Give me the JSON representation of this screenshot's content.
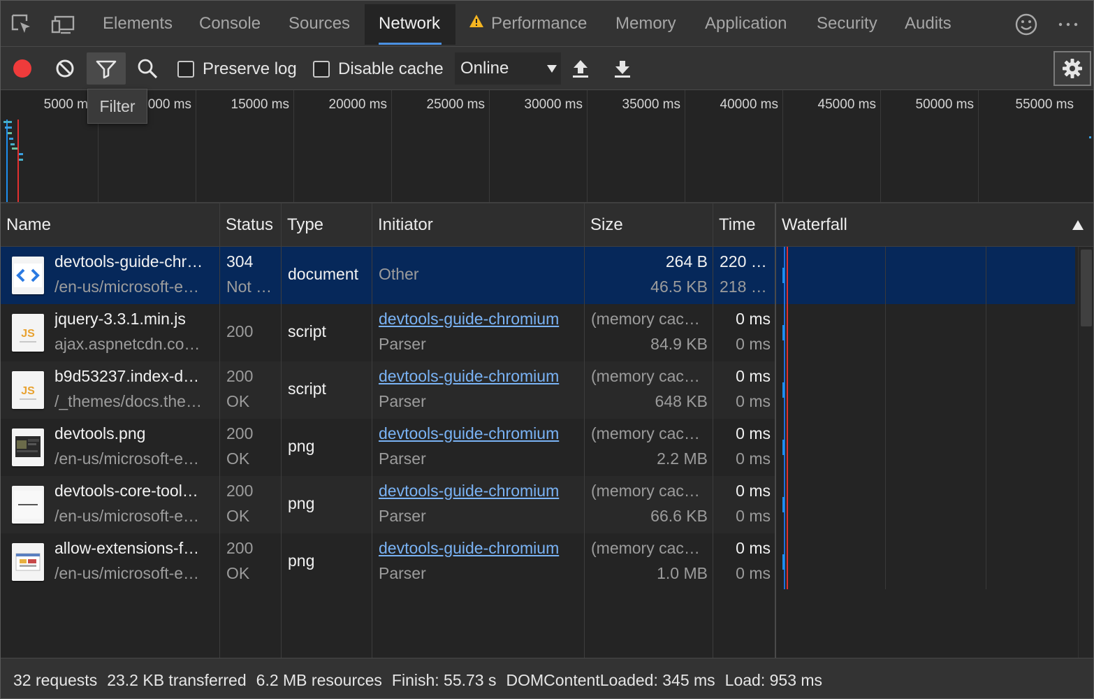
{
  "tabs": [
    {
      "label": "Elements"
    },
    {
      "label": "Console"
    },
    {
      "label": "Sources"
    },
    {
      "label": "Network"
    },
    {
      "label": "Performance"
    },
    {
      "label": "Memory"
    },
    {
      "label": "Application"
    },
    {
      "label": "Security"
    },
    {
      "label": "Audits"
    }
  ],
  "active_tab": "Network",
  "toolbar": {
    "preserve_log": "Preserve log",
    "disable_cache": "Disable cache",
    "throttle": "Online",
    "filter_tooltip": "Filter"
  },
  "overview": {
    "ticks": [
      "5000 ms",
      "10000 ms",
      "15000 ms",
      "20000 ms",
      "25000 ms",
      "30000 ms",
      "35000 ms",
      "40000 ms",
      "45000 ms",
      "50000 ms",
      "55000 ms"
    ],
    "visible_ticks": [
      "5000 m",
      "000 ms",
      "15000 ms",
      "20000 ms",
      "25000 ms",
      "30000 ms",
      "35000 ms",
      "40000 ms",
      "45000 ms",
      "50000 ms",
      "55000 ms"
    ]
  },
  "columns": {
    "name": "Name",
    "status": "Status",
    "type": "Type",
    "initiator": "Initiator",
    "size": "Size",
    "time": "Time",
    "waterfall": "Waterfall"
  },
  "requests": [
    {
      "name": "devtools-guide-chr…",
      "path": "/en-us/microsoft-e…",
      "status": "304",
      "status_text": "Not …",
      "type": "document",
      "initiator": "Other",
      "initiator_sub": "",
      "size": "264 B",
      "size_sub": "46.5 KB",
      "time": "220 …",
      "time_sub": "218 …",
      "icon": "html-file-icon"
    },
    {
      "name": "jquery-3.3.1.min.js",
      "path": "ajax.aspnetcdn.co…",
      "status": "200",
      "status_text": "",
      "type": "script",
      "initiator": "devtools-guide-chromium",
      "initiator_sub": "Parser",
      "size": "(memory cac…",
      "size_sub": "84.9 KB",
      "time": "0 ms",
      "time_sub": "0 ms",
      "icon": "js-file-icon"
    },
    {
      "name": "b9d53237.index-d…",
      "path": "/_themes/docs.the…",
      "status": "200",
      "status_text": "OK",
      "type": "script",
      "initiator": "devtools-guide-chromium",
      "initiator_sub": "Parser",
      "size": "(memory cac…",
      "size_sub": "648 KB",
      "time": "0 ms",
      "time_sub": "0 ms",
      "icon": "js-file-icon"
    },
    {
      "name": "devtools.png",
      "path": "/en-us/microsoft-e…",
      "status": "200",
      "status_text": "OK",
      "type": "png",
      "initiator": "devtools-guide-chromium",
      "initiator_sub": "Parser",
      "size": "(memory cac…",
      "size_sub": "2.2 MB",
      "time": "0 ms",
      "time_sub": "0 ms",
      "icon": "image-thumbnail-icon"
    },
    {
      "name": "devtools-core-tool…",
      "path": "/en-us/microsoft-e…",
      "status": "200",
      "status_text": "OK",
      "type": "png",
      "initiator": "devtools-guide-chromium",
      "initiator_sub": "Parser",
      "size": "(memory cac…",
      "size_sub": "66.6 KB",
      "time": "0 ms",
      "time_sub": "0 ms",
      "icon": "image-thumbnail-icon"
    },
    {
      "name": "allow-extensions-f…",
      "path": "/en-us/microsoft-e…",
      "status": "200",
      "status_text": "OK",
      "type": "png",
      "initiator": "devtools-guide-chromium",
      "initiator_sub": "Parser",
      "size": "(memory cac…",
      "size_sub": "1.0 MB",
      "time": "0 ms",
      "time_sub": "0 ms",
      "icon": "image-thumbnail-icon"
    }
  ],
  "summary": {
    "requests": "32 requests",
    "transferred": "23.2 KB transferred",
    "resources": "6.2 MB resources",
    "finish": "Finish: 55.73 s",
    "dom": "DOMContentLoaded: 345 ms",
    "load": "Load: 953 ms"
  },
  "colors": {
    "record": "#ef3b3b",
    "selection": "#06285a",
    "link": "#7ab3f5",
    "waterfall_bar": "#1e8ff0",
    "dom_content_line": "#1e6fe0",
    "load_line": "#e03030"
  }
}
